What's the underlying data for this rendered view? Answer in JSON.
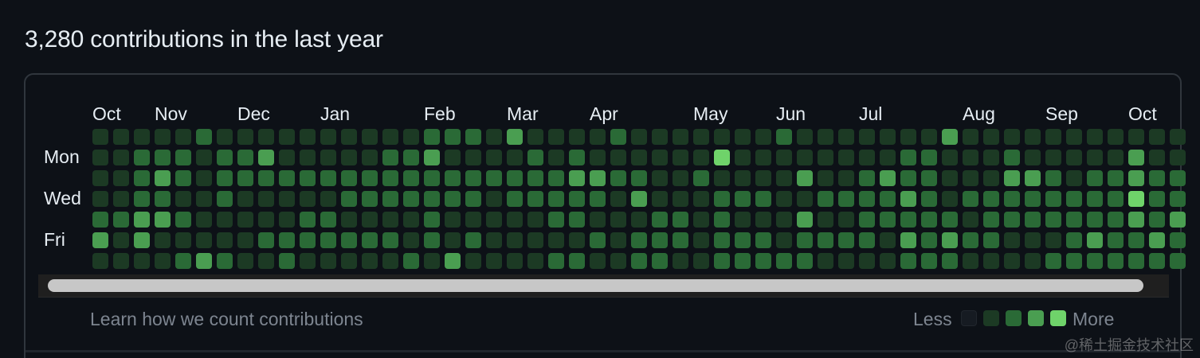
{
  "heading": "3,280 contributions in the last year",
  "months": [
    "Oct",
    "Nov",
    "Dec",
    "Jan",
    "Feb",
    "Mar",
    "Apr",
    "May",
    "Jun",
    "Jul",
    "Aug",
    "Sep",
    "Oct"
  ],
  "day_labels": [
    "Mon",
    "Wed",
    "Fri"
  ],
  "footer": {
    "learn_link": "Learn how we count contributions",
    "legend_less": "Less",
    "legend_more": "More"
  },
  "watermark": "@稀土掘金技术社区",
  "colors": {
    "level0": "#161b22",
    "level1": "#0e4429",
    "level2": "#006d32",
    "level3": "#26a641",
    "level4": "#39d353",
    "rendered_level1": "#1c3a24",
    "rendered_level2": "#2a6a36",
    "rendered_level3": "#4a9e51",
    "rendered_level4": "#6fd36a"
  },
  "contributions": {
    "weeks": 53,
    "levels_by_day": [
      "11111211111111112221311112111111121111111311111111111",
      "11222122311111223111121211111141111111122111211111311",
      "11232122222222222222222332211211113112322111332122322",
      "11221121111122222221222221311122211222232122222222422",
      "22332111112211112111112211122121113112222212222222323",
      "31311111222222212121111121222122212222132322111232232",
      "11112321121111121311112211221122222111122211112222222"
    ]
  }
}
